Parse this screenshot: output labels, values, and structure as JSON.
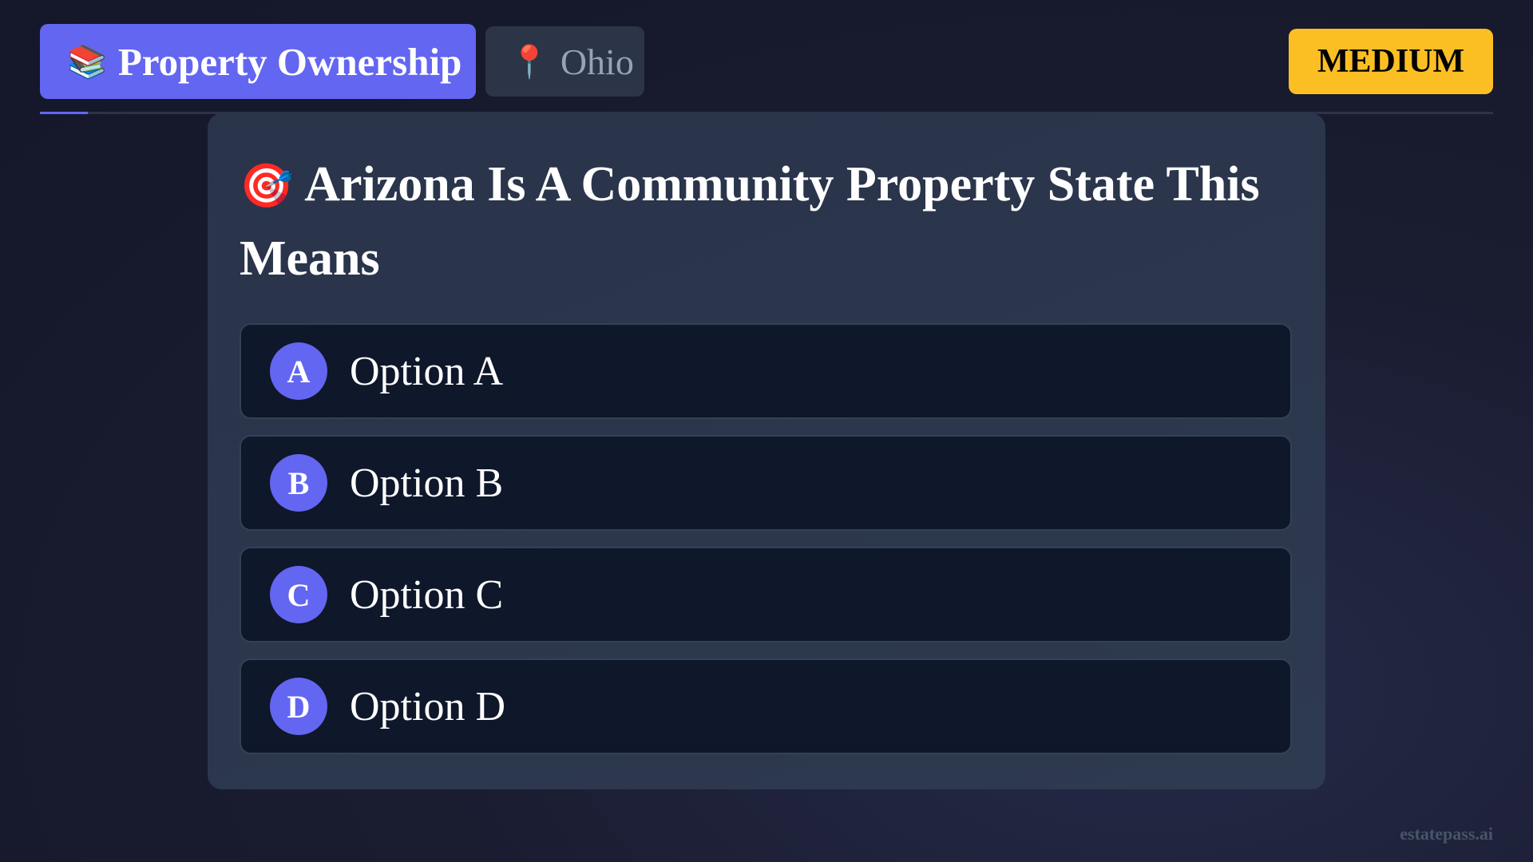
{
  "header": {
    "category_icon": "📚",
    "category_label": "Property Ownership",
    "state_icon": "📍",
    "state_label": "Ohio",
    "difficulty_label": "MEDIUM"
  },
  "progress": {
    "fraction": 0.033
  },
  "question": {
    "icon": "🎯",
    "text": "Arizona Is A Community Property State This Means"
  },
  "options": [
    {
      "letter": "A",
      "text": "Option A"
    },
    {
      "letter": "B",
      "text": "Option B"
    },
    {
      "letter": "C",
      "text": "Option C"
    },
    {
      "letter": "D",
      "text": "Option D"
    }
  ],
  "footer": {
    "watermark": "estatepass.ai"
  },
  "colors": {
    "accent": "#6366f1",
    "difficulty_badge": "#fbbf24",
    "card_bg": "#2e3a50",
    "option_bg": "#0f172a"
  }
}
